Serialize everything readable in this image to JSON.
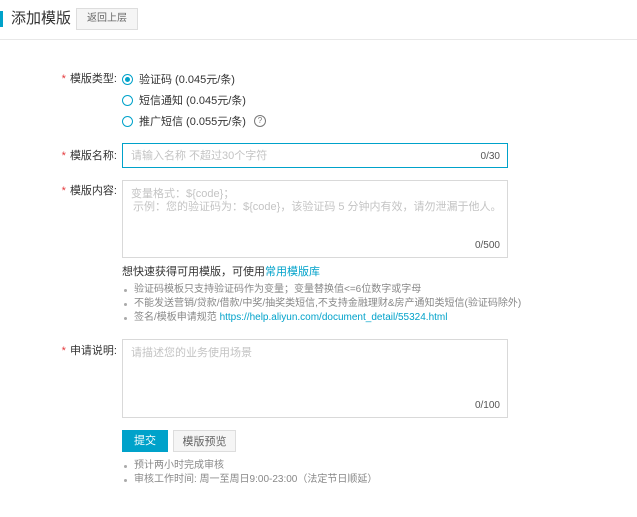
{
  "header": {
    "title": "添加模版",
    "back_label": "返回上层"
  },
  "form": {
    "type": {
      "label": "模版类型:",
      "options": [
        {
          "label": "验证码 (0.045元/条)",
          "selected": true
        },
        {
          "label": "短信通知 (0.045元/条)",
          "selected": false
        },
        {
          "label": "推广短信 (0.055元/条)",
          "selected": false
        }
      ],
      "help_symbol": "?"
    },
    "name": {
      "label": "模版名称:",
      "placeholder": "请输入名称 不超过30个字符",
      "counter": "0/30"
    },
    "content": {
      "label": "模版内容:",
      "placeholder_line1": "变量格式：${code}；",
      "placeholder_line2": "示例：您的验证码为：${code}，该验证码 5 分钟内有效，请勿泄漏于他人。",
      "counter": "0/500"
    },
    "library_hint": {
      "text": "想快速获得可用模版，可使用",
      "link": "常用模版库"
    },
    "tips": [
      "验证码模板只支持验证码作为变量；变量替换值<=6位数字或字母",
      "不能发送营销/贷款/借款/中奖/抽奖类短信,不支持金融理财&房产通知类短信(验证码除外)"
    ],
    "spec_tip": {
      "text": "签名/模板申请规范",
      "url": "https://help.aliyun.com/document_detail/55324.html"
    },
    "reason": {
      "label": "申请说明:",
      "placeholder": "请描述您的业务使用场景",
      "counter": "0/100"
    },
    "required_mark": "*",
    "submit_label": "提交",
    "preview_label": "模版预览",
    "footer_tips": [
      "预计两小时完成审核",
      "审核工作时间: 周一至周日9:00-23:00（法定节日顺延）"
    ]
  },
  "colors": {
    "accent": "#00a2ca",
    "required": "#e4393c"
  }
}
